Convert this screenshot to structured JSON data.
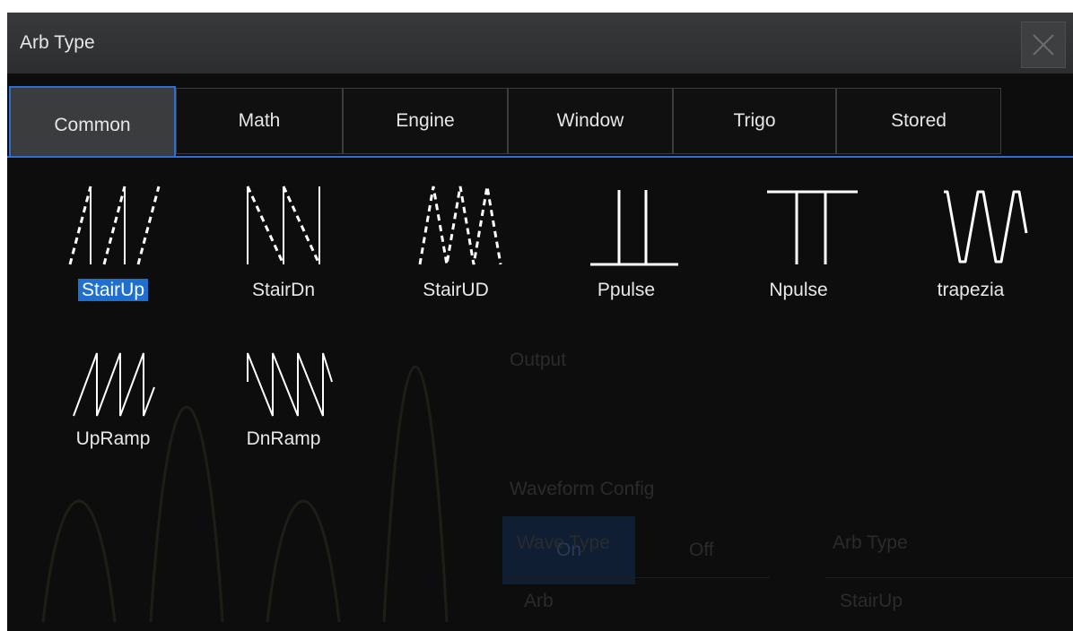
{
  "dialog": {
    "title": "Arb Type",
    "close_icon": "close-icon"
  },
  "tabs": [
    {
      "label": "Common",
      "active": true
    },
    {
      "label": "Math",
      "active": false
    },
    {
      "label": "Engine",
      "active": false
    },
    {
      "label": "Window",
      "active": false
    },
    {
      "label": "Trigo",
      "active": false
    },
    {
      "label": "Stored",
      "active": false
    }
  ],
  "waveforms": [
    {
      "label": "StairUp",
      "icon": "stairup-wave-icon",
      "selected": true
    },
    {
      "label": "StairDn",
      "icon": "stairdn-wave-icon",
      "selected": false
    },
    {
      "label": "StairUD",
      "icon": "stairud-wave-icon",
      "selected": false
    },
    {
      "label": "Ppulse",
      "icon": "ppulse-wave-icon",
      "selected": false
    },
    {
      "label": "Npulse",
      "icon": "npulse-wave-icon",
      "selected": false
    },
    {
      "label": "trapezia",
      "icon": "trapezia-wave-icon",
      "selected": false
    },
    {
      "label": "UpRamp",
      "icon": "upramp-wave-icon",
      "selected": false
    },
    {
      "label": "DnRamp",
      "icon": "dnramp-wave-icon",
      "selected": false
    }
  ],
  "background_panel": {
    "output_label": "Output",
    "on_label": "On",
    "off_label": "Off",
    "waveform_config_label": "Waveform Config",
    "wave_type_label": "Wave Type",
    "wave_type_value": "Arb",
    "arb_type_label": "Arb Type",
    "arb_type_value": "StairUp"
  },
  "colors": {
    "accent": "#2e6fd6",
    "selection": "#1f6fd1",
    "background": "#0d0d0e"
  }
}
